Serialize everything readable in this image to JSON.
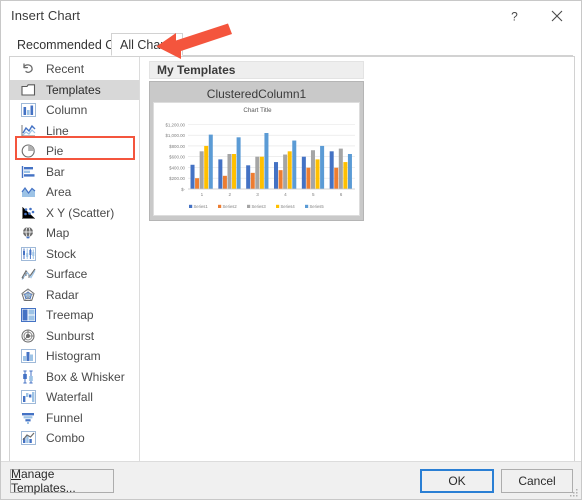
{
  "window": {
    "title": "Insert Chart",
    "help_label": "?",
    "close_label": "✕"
  },
  "tabs": [
    {
      "label": "Recommended Charts",
      "active": false
    },
    {
      "label": "All Charts",
      "active": true
    }
  ],
  "chart_types": {
    "selected": "Templates",
    "items": [
      {
        "label": "Recent",
        "icon": "recent-undo-icon"
      },
      {
        "label": "Templates",
        "icon": "templates-folder-icon"
      },
      {
        "label": "Column",
        "icon": "column-chart-icon"
      },
      {
        "label": "Line",
        "icon": "line-chart-icon"
      },
      {
        "label": "Pie",
        "icon": "pie-chart-icon"
      },
      {
        "label": "Bar",
        "icon": "bar-chart-icon"
      },
      {
        "label": "Area",
        "icon": "area-chart-icon"
      },
      {
        "label": "X Y (Scatter)",
        "icon": "scatter-chart-icon"
      },
      {
        "label": "Map",
        "icon": "map-globe-icon"
      },
      {
        "label": "Stock",
        "icon": "stock-chart-icon"
      },
      {
        "label": "Surface",
        "icon": "surface-chart-icon"
      },
      {
        "label": "Radar",
        "icon": "radar-chart-icon"
      },
      {
        "label": "Treemap",
        "icon": "treemap-chart-icon"
      },
      {
        "label": "Sunburst",
        "icon": "sunburst-chart-icon"
      },
      {
        "label": "Histogram",
        "icon": "histogram-chart-icon"
      },
      {
        "label": "Box & Whisker",
        "icon": "box-whisker-chart-icon"
      },
      {
        "label": "Waterfall",
        "icon": "waterfall-chart-icon"
      },
      {
        "label": "Funnel",
        "icon": "funnel-chart-icon"
      },
      {
        "label": "Combo",
        "icon": "combo-chart-icon"
      }
    ]
  },
  "gallery": {
    "group_header": "My Templates",
    "template_name": "ClusteredColumn1"
  },
  "footer": {
    "manage_templates": "Manage Templates...",
    "manage_templates_accel": "M",
    "manage_templates_rest": "anage Templates...",
    "ok": "OK",
    "cancel": "Cancel"
  },
  "annotation": {
    "type": "arrow",
    "color": "#f4553d",
    "points_to": "All Charts tab",
    "highlight_color": "#f4553d",
    "highlight_target": "Templates"
  },
  "chart_data": {
    "type": "bar",
    "title": "Chart Title",
    "xlabel": "",
    "ylabel": "",
    "categories": [
      "1",
      "2",
      "3",
      "4",
      "5",
      "6"
    ],
    "ytick_labels": [
      "$-",
      "$200.00",
      "$400.00",
      "$600.00",
      "$800.00",
      "$1,000.00",
      "$1,200.00"
    ],
    "ytick_values": [
      0,
      200,
      400,
      600,
      800,
      1000,
      1200
    ],
    "ylim": [
      0,
      1300
    ],
    "grid": true,
    "legend_position": "bottom",
    "series": [
      {
        "name": "Series1",
        "color": "#4472c4",
        "values": [
          450,
          550,
          440,
          500,
          600,
          700
        ]
      },
      {
        "name": "Series2",
        "color": "#ed7d31",
        "values": [
          200,
          245,
          300,
          350,
          395,
          395
        ]
      },
      {
        "name": "Series3",
        "color": "#a5a5a5",
        "values": [
          700,
          650,
          600,
          640,
          720,
          750
        ]
      },
      {
        "name": "Series4",
        "color": "#ffc000",
        "values": [
          800,
          650,
          600,
          700,
          550,
          500
        ]
      },
      {
        "name": "Series5",
        "color": "#5b9bd5",
        "values": [
          1010,
          960,
          1040,
          900,
          800,
          650
        ]
      }
    ]
  }
}
